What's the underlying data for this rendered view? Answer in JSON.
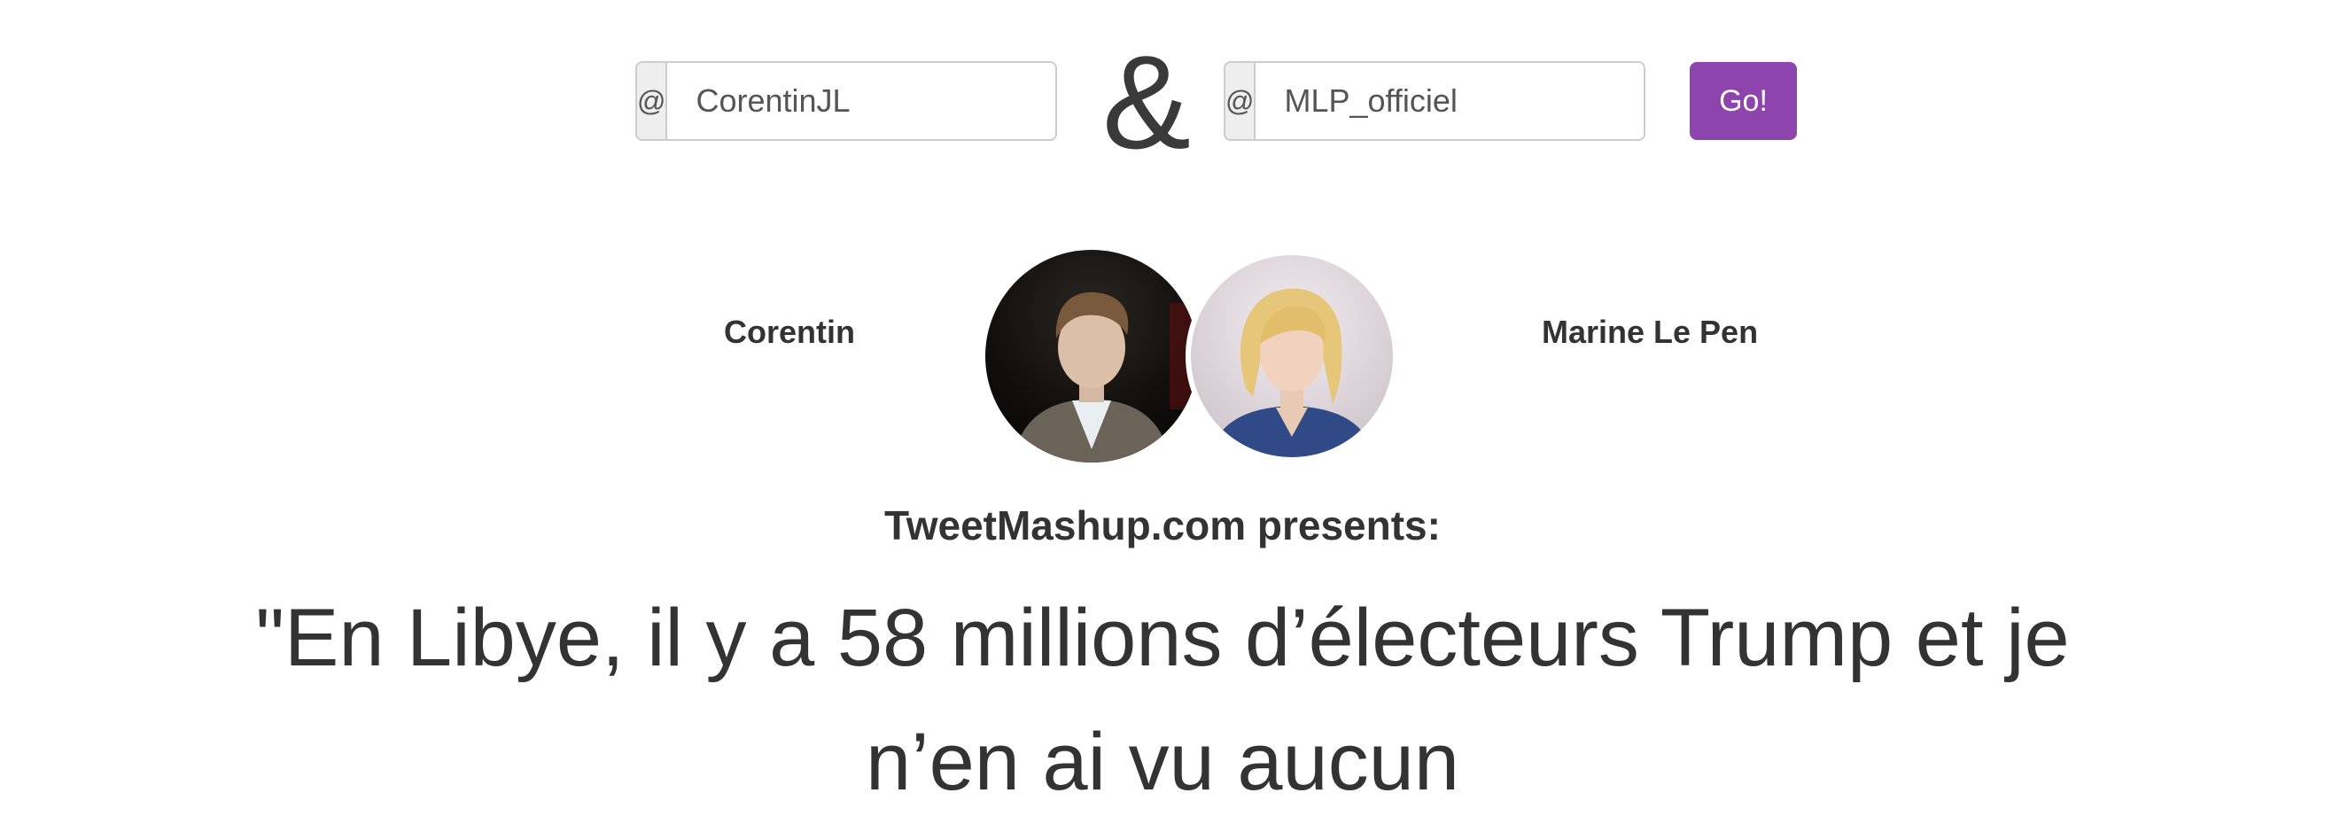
{
  "form": {
    "left_addon": "@",
    "left_value": "CorentinJL",
    "ampersand": "&",
    "right_addon": "@",
    "right_value": "MLP_officiel",
    "go_label": "Go!",
    "button_color": "#8e44ad"
  },
  "profiles": {
    "left_name": "Corentin",
    "right_name": "Marine Le Pen"
  },
  "presents": "TweetMashup.com presents:",
  "quote": "\"En Libye, il y a 58 millions d’électeurs Trump et je n’en ai vu aucun"
}
